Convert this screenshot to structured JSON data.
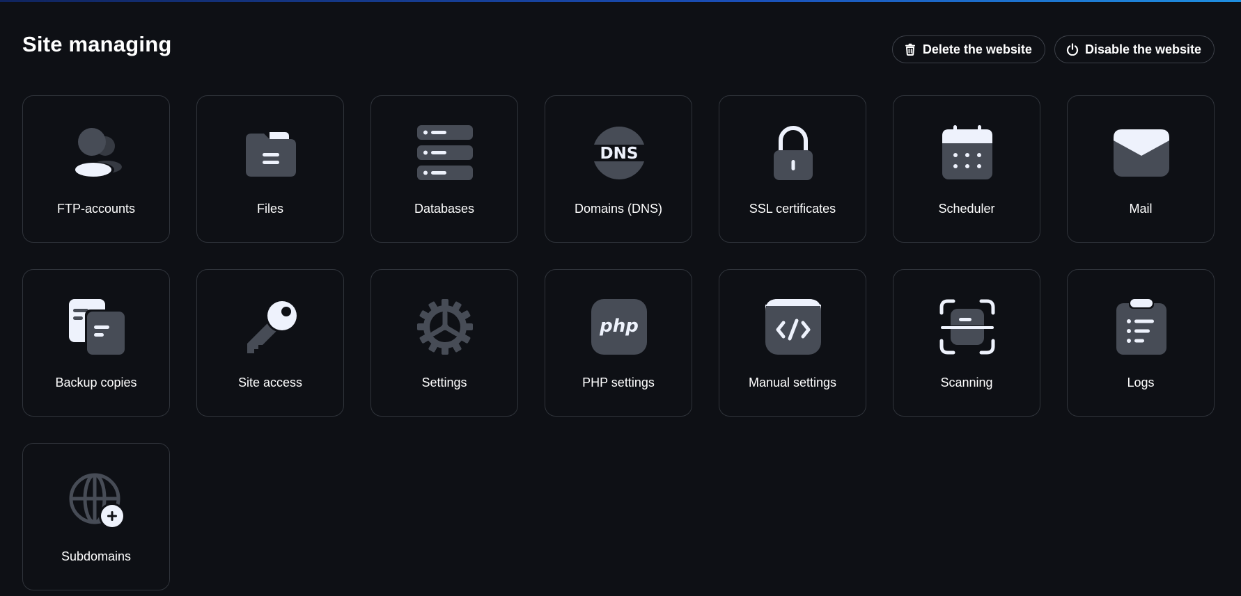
{
  "page": {
    "title": "Site managing"
  },
  "actions": {
    "delete_label": "Delete the website",
    "disable_label": "Disable the website"
  },
  "tiles": [
    {
      "label": "FTP-accounts",
      "icon": "users-icon"
    },
    {
      "label": "Files",
      "icon": "folder-icon"
    },
    {
      "label": "Databases",
      "icon": "database-icon"
    },
    {
      "label": "Domains (DNS)",
      "icon": "dns-icon"
    },
    {
      "label": "SSL certificates",
      "icon": "lock-icon"
    },
    {
      "label": "Scheduler",
      "icon": "calendar-icon"
    },
    {
      "label": "Mail",
      "icon": "mail-icon"
    },
    {
      "label": "Backup copies",
      "icon": "copy-icon"
    },
    {
      "label": "Site access",
      "icon": "key-icon"
    },
    {
      "label": "Settings",
      "icon": "gear-icon"
    },
    {
      "label": "PHP settings",
      "icon": "php-icon"
    },
    {
      "label": "Manual settings",
      "icon": "code-icon"
    },
    {
      "label": "Scanning",
      "icon": "scan-icon"
    },
    {
      "label": "Logs",
      "icon": "clipboard-list-icon"
    },
    {
      "label": "Subdomains",
      "icon": "globe-plus-icon"
    }
  ],
  "icon_text": {
    "dns": "DNS",
    "php": "php"
  },
  "colors": {
    "background": "#0e1015",
    "tile_border": "#30343b",
    "icon_dark": "#474c56",
    "icon_light": "#eef2fc",
    "accent_bar": "#1a4fb8"
  }
}
